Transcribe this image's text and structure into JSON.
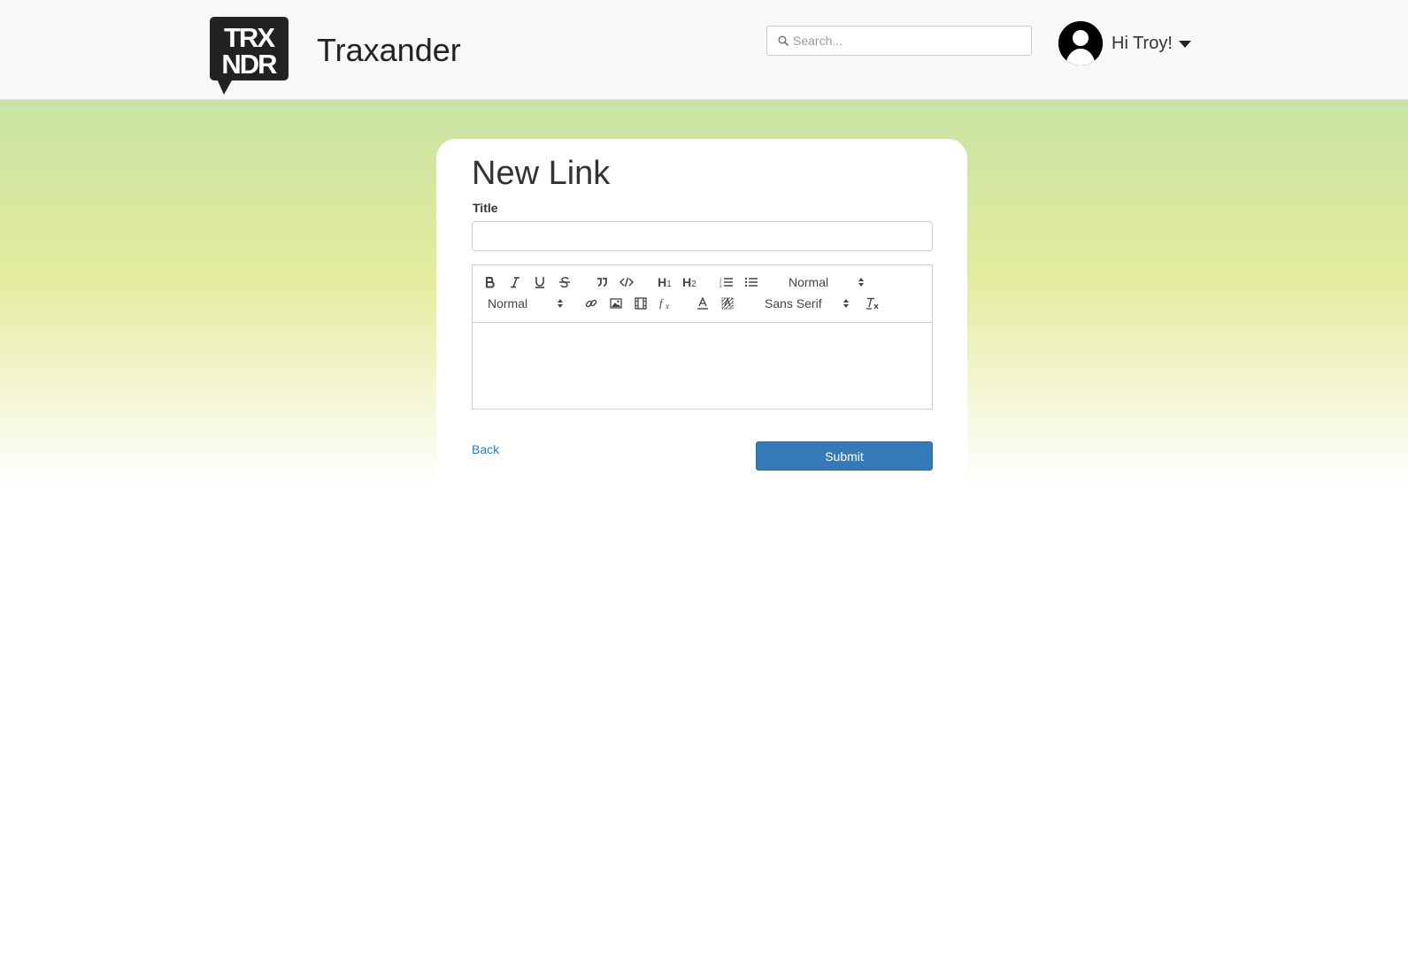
{
  "header": {
    "logo_text": "TRX NDR",
    "brand": "Traxander",
    "search_placeholder": "Search...",
    "greeting": "Hi Troy!"
  },
  "form": {
    "heading": "New Link",
    "title_label": "Title",
    "title_value": "",
    "toolbar": {
      "size_select": "Normal",
      "header_select": "Normal",
      "font_select": "Sans Serif",
      "buttons": [
        "bold-icon",
        "italic-icon",
        "underline-icon",
        "strikethrough-icon",
        "blockquote-icon",
        "code-block-icon",
        "h1-icon",
        "h2-icon",
        "ordered-list-icon",
        "bullet-list-icon",
        "link-icon",
        "image-icon",
        "video-icon",
        "formula-icon",
        "text-color-icon",
        "background-color-icon",
        "clear-formatting-icon"
      ]
    },
    "h1_label": "H",
    "h2_label": "H",
    "back_label": "Back",
    "submit_label": "Submit"
  },
  "colors": {
    "primary": "#337ab7",
    "link": "#337ab7",
    "navbar_bg": "#f8f8f8",
    "hero_top": "#c8e3a3",
    "hero_mid": "#e3ec9d"
  }
}
